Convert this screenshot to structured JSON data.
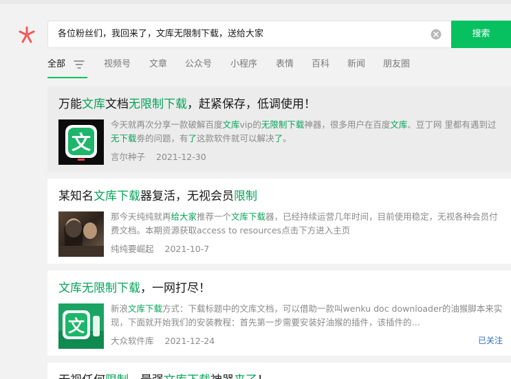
{
  "search": {
    "query": "各位粉丝们，我回来了，文库无限制下载，送给大家",
    "button_label": "搜索"
  },
  "tabs": [
    {
      "label": "全部",
      "active": true
    },
    {
      "label": "视频号"
    },
    {
      "label": "文章"
    },
    {
      "label": "公众号"
    },
    {
      "label": "小程序"
    },
    {
      "label": "表情"
    },
    {
      "label": "百科"
    },
    {
      "label": "新闻"
    },
    {
      "label": "朋友圈"
    }
  ],
  "results": [
    {
      "title": [
        {
          "t": "万能"
        },
        {
          "t": "文库",
          "hl": true
        },
        {
          "t": "文档"
        },
        {
          "t": "无限制下载",
          "hl": true
        },
        {
          "t": "，赶紧保存，低调使用！"
        }
      ],
      "desc": [
        {
          "t": "今天就再次分享一款破解百度"
        },
        {
          "t": "文库",
          "hl": true
        },
        {
          "t": "vip的"
        },
        {
          "t": "无限制下载",
          "hl": true
        },
        {
          "t": "神器，很多用户在百度"
        },
        {
          "t": "文库",
          "hl": true
        },
        {
          "t": "、豆丁网 里都有遇到过"
        },
        {
          "t": "无下载",
          "hl": true
        },
        {
          "t": "劵的问题，有"
        },
        {
          "t": "了",
          "hl": true
        },
        {
          "t": "这款软件就可以解决"
        },
        {
          "t": "了",
          "hl": true
        },
        {
          "t": "。"
        }
      ],
      "source": "言尔种子",
      "date": "2021-12-30"
    },
    {
      "title": [
        {
          "t": "某知名"
        },
        {
          "t": "文库下载",
          "hl": true
        },
        {
          "t": "器复活，无视会员"
        },
        {
          "t": "限制",
          "hl": true
        }
      ],
      "desc": [
        {
          "t": "那今天纯纯就再"
        },
        {
          "t": "给大家",
          "hl": true
        },
        {
          "t": "推荐一个"
        },
        {
          "t": "文库下载",
          "hl": true
        },
        {
          "t": "器，已经持续运营几年时间，目前使用稳定，无视各种会员付费文档。本期资源获取access to resources点击下方进入主页"
        }
      ],
      "source": "纯纯要崛起",
      "date": "2021-10-7"
    },
    {
      "title": [
        {
          "t": "文库无限制下载",
          "hl": true
        },
        {
          "t": "，一网打尽！"
        }
      ],
      "desc": [
        {
          "t": "新浪"
        },
        {
          "t": "文库下载",
          "hl": true
        },
        {
          "t": "方式：下载标题中的文库文档，可以借助一款叫wenku doc downloader的油猴脚本来实现，下面就开始我们的安装教程：首先第一步需要安装好油猴的插件，该插件的…"
        }
      ],
      "source": "大众软件库",
      "date": "2021-12-24",
      "badge": "已关注"
    },
    {
      "title": [
        {
          "t": "无视任何"
        },
        {
          "t": "限制",
          "hl": true
        },
        {
          "t": "，最强"
        },
        {
          "t": "文库下载",
          "hl": true
        },
        {
          "t": "神器"
        },
        {
          "t": "来了",
          "hl": true
        },
        {
          "t": "！"
        }
      ]
    }
  ],
  "icons": {
    "logo": "wechat-search-logo",
    "clear": "clear-icon",
    "filter": "filter-icon"
  },
  "colors": {
    "accent": "#07c160",
    "highlight_text": "#07a35a",
    "followed_badge": "#2f6fc1"
  }
}
